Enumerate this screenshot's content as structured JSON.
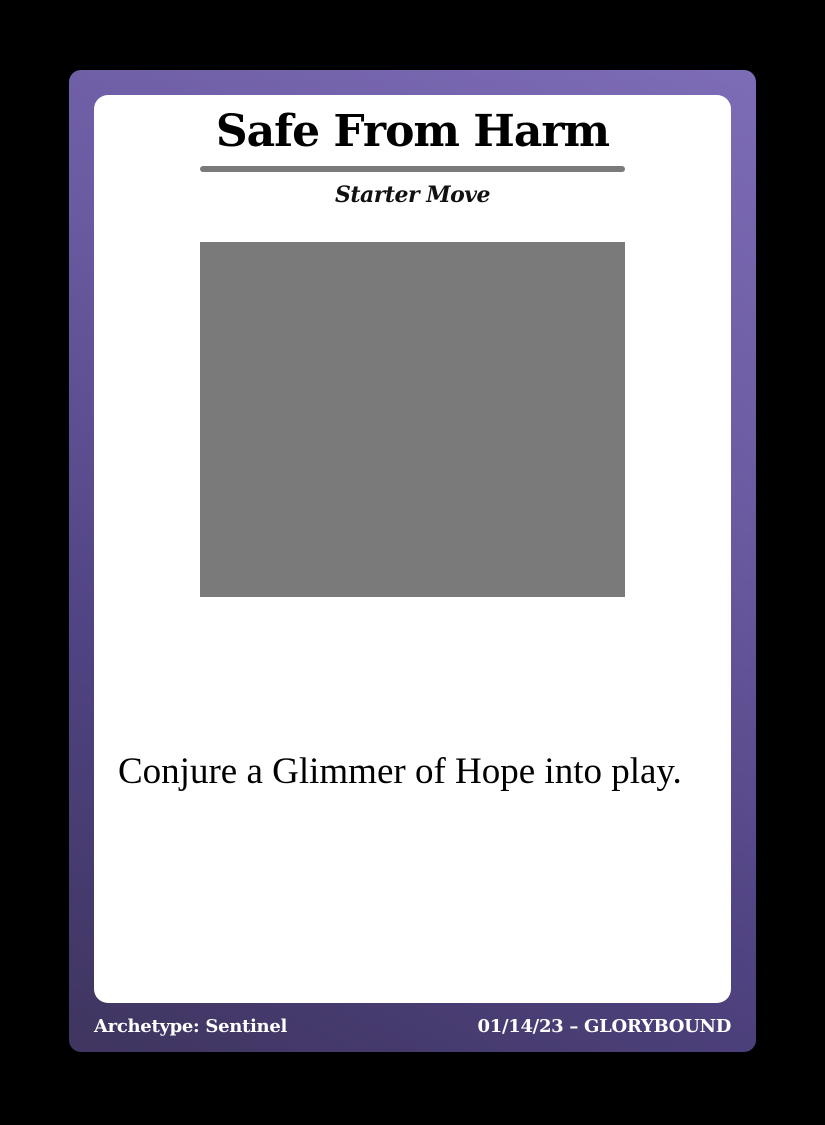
{
  "card": {
    "title": "Safe From Harm",
    "type_line": "Starter Move",
    "rules_text": "Conjure a Glimmer of Hope into play.",
    "footer": {
      "archetype": "Archetype: Sentinel",
      "date": "01/14/23",
      "separator": "–",
      "publisher": "GLORYBOUND"
    },
    "colors": {
      "frame_top": "#7d6cb6",
      "frame_bottom": "#3f355f",
      "art_placeholder": "#7a7a7a",
      "title_rule": "#7a7a7a"
    }
  }
}
